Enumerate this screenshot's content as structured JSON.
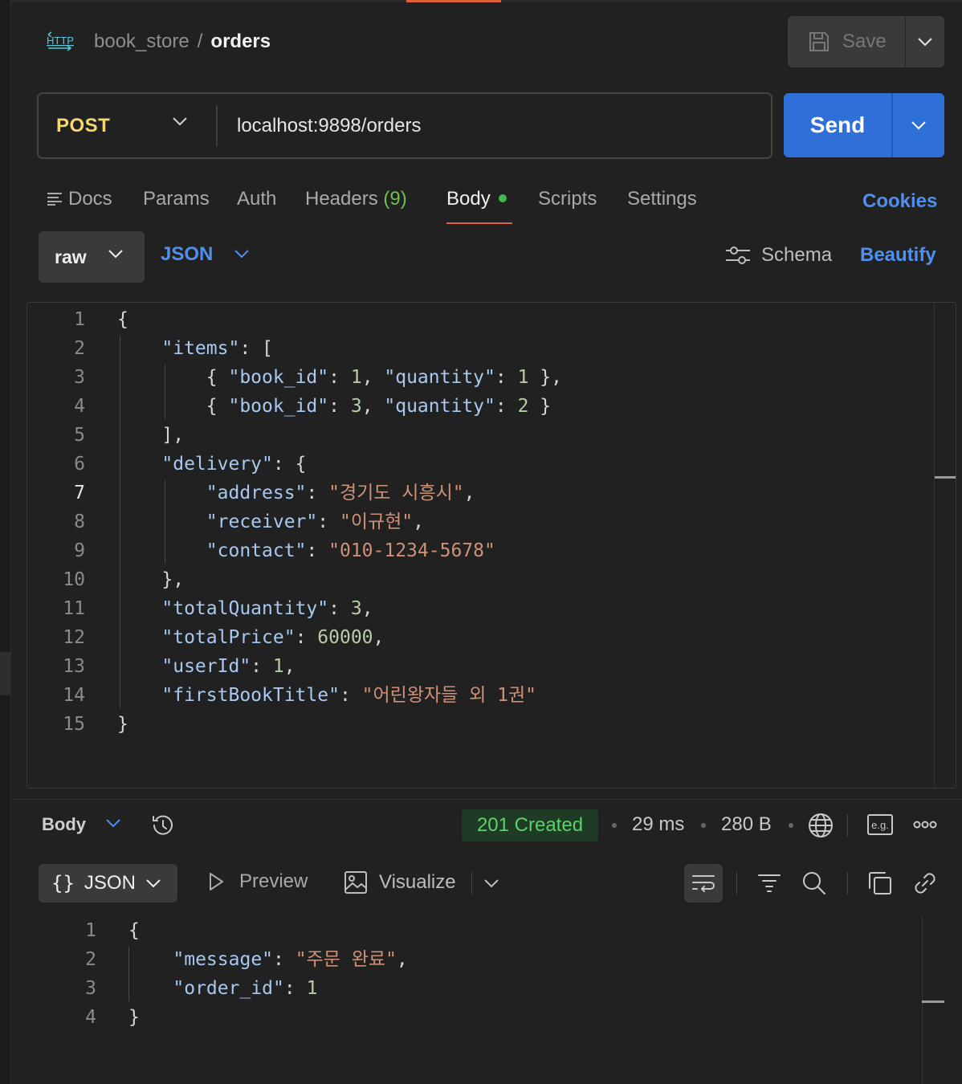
{
  "breadcrumb": {
    "collection": "book_store",
    "separator": "/",
    "request": "orders"
  },
  "header": {
    "save_label": "Save"
  },
  "request": {
    "method": "POST",
    "url": "localhost:9898/orders",
    "send_label": "Send"
  },
  "tabs": {
    "docs": "Docs",
    "params": "Params",
    "auth": "Auth",
    "headers": "Headers",
    "headers_count": "(9)",
    "body": "Body",
    "scripts": "Scripts",
    "settings": "Settings",
    "cookies": "Cookies"
  },
  "body_toolbar": {
    "mode": "raw",
    "format": "JSON",
    "schema": "Schema",
    "beautify": "Beautify"
  },
  "request_body_lines": [
    "{",
    "    \"items\": [",
    "        { \"book_id\": 1, \"quantity\": 1 },",
    "        { \"book_id\": 3, \"quantity\": 2 }",
    "    ],",
    "    \"delivery\": {",
    "        \"address\": \"경기도 시흥시\",",
    "        \"receiver\": \"이규현\",",
    "        \"contact\": \"010-1234-5678\"",
    "    },",
    "    \"totalQuantity\": 3,",
    "    \"totalPrice\": 60000,",
    "    \"userId\": 1,",
    "    \"firstBookTitle\": \"어린왕자들 외 1권\"",
    "}"
  ],
  "response": {
    "body_label": "Body",
    "status": "201 Created",
    "time": "29 ms",
    "size": "280 B",
    "eg_label": "e.g.",
    "view_json": "JSON",
    "view_preview": "Preview",
    "view_visualize": "Visualize",
    "lines": [
      "{",
      "    \"message\": \"주문 완료\",",
      "    \"order_id\": 1",
      "}"
    ]
  },
  "colors": {
    "accent_blue": "#2e6fd8",
    "link_blue": "#4f8ff0",
    "method_yellow": "#f5d76e",
    "status_green": "#5ad16a",
    "tab_underline": "#e0603a"
  }
}
